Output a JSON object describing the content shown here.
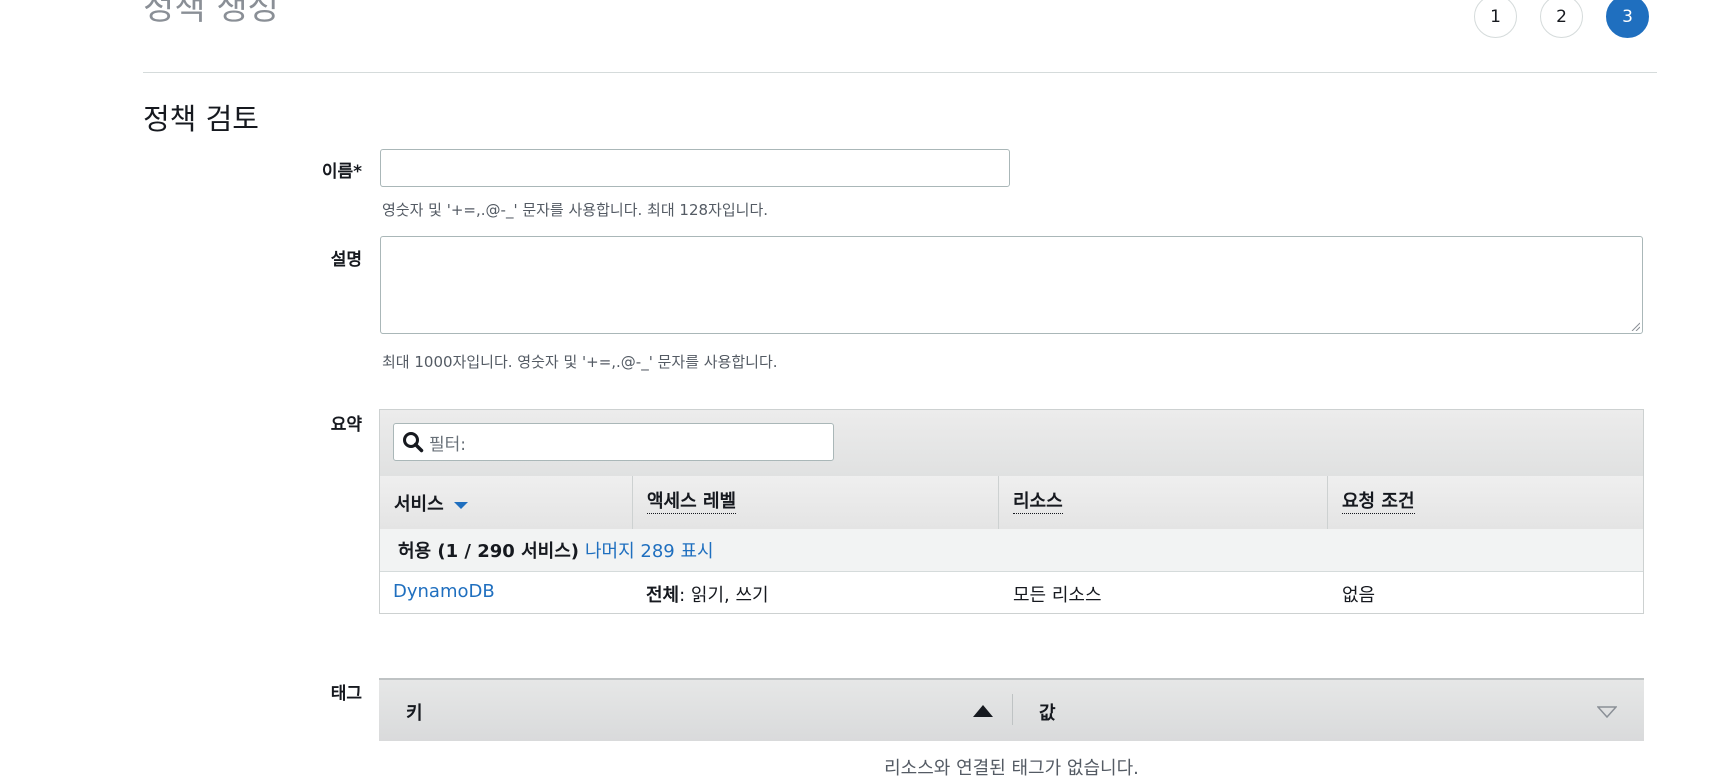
{
  "page_title": "정책 생성",
  "steps": [
    "1",
    "2",
    "3"
  ],
  "active_step": "3",
  "section_title": "정책 검토",
  "name_field": {
    "label": "이름*",
    "value": "",
    "hint": "영숫자 및 '+=,.@-_' 문자를 사용합니다. 최대 128자입니다."
  },
  "description_field": {
    "label": "설명",
    "value": "",
    "hint": "최대 1000자입니다. 영숫자 및 '+=,.@-_' 문자를 사용합니다."
  },
  "summary": {
    "label": "요약",
    "filter_placeholder": "필터:",
    "columns": [
      "서비스",
      "액세스 레벨",
      "리소스",
      "요청 조건"
    ],
    "group": {
      "label": "허용 (1 / 290 서비스)",
      "link": "나머지 289 표시"
    },
    "rows": [
      {
        "service": "DynamoDB",
        "access_bold": "전체",
        "access_rest": ": 읽기, 쓰기",
        "resource": "모든 리소스",
        "condition": "없음"
      }
    ]
  },
  "tags": {
    "label": "태그",
    "key_header": "키",
    "value_header": "값",
    "empty_message": "리소스와 연결된 태그가 없습니다."
  },
  "colors": {
    "accent": "#1f6fbf",
    "text": "#16191f",
    "muted": "#545b64"
  }
}
